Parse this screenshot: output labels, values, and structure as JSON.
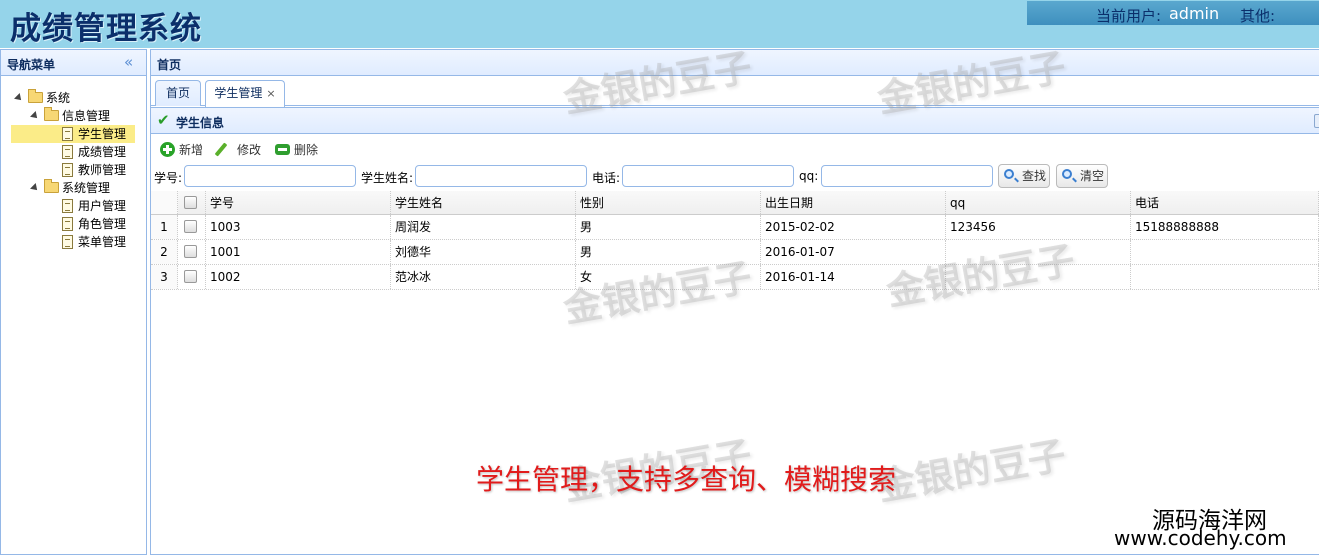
{
  "app": {
    "title": "成绩管理系统",
    "user_label": "当前用户:",
    "username": "admin",
    "other_label": "其他:"
  },
  "nav": {
    "title": "导航菜单",
    "tree": [
      {
        "label": "系统"
      },
      {
        "label": "信息管理"
      },
      {
        "label": "学生管理",
        "selected": true
      },
      {
        "label": "成绩管理"
      },
      {
        "label": "教师管理"
      },
      {
        "label": "系统管理"
      },
      {
        "label": "用户管理"
      },
      {
        "label": "角色管理"
      },
      {
        "label": "菜单管理"
      }
    ]
  },
  "center": {
    "title": "首页",
    "tabs": [
      {
        "label": "首页"
      },
      {
        "label": "学生管理",
        "closable": true,
        "active": true
      }
    ],
    "close_glyph": "×"
  },
  "grid": {
    "title": "学生信息",
    "toolbar": {
      "add": "新增",
      "edit": "修改",
      "delete": "删除"
    },
    "search": {
      "id_label": "学号:",
      "name_label": "学生姓名:",
      "phone_label": "电话:",
      "qq_label": "qq:",
      "search_button": "查找",
      "clear_button": "清空"
    },
    "columns": [
      "学号",
      "学生姓名",
      "性别",
      "出生日期",
      "qq",
      "电话"
    ],
    "rows": [
      {
        "n": "1",
        "id": "1003",
        "name": "周润发",
        "sex": "男",
        "birth": "2015-02-02",
        "qq": "123456",
        "phone": "15188888888"
      },
      {
        "n": "2",
        "id": "1001",
        "name": "刘德华",
        "sex": "男",
        "birth": "2016-01-07",
        "qq": "",
        "phone": ""
      },
      {
        "n": "3",
        "id": "1002",
        "name": "范冰冰",
        "sex": "女",
        "birth": "2016-01-14",
        "qq": "",
        "phone": ""
      }
    ]
  },
  "overlay": {
    "watermark": "金银的豆子",
    "caption": "学生管理，支持多查询、模糊搜索",
    "site_name": "源码海洋网",
    "site_url": "www.codehy.com"
  },
  "colors": {
    "header_bg": "#95d4ea",
    "title_color": "#0b2f6b",
    "panel_border": "#95b8e7",
    "selected_node": "#fbec88",
    "caption_color": "#e11b1b"
  }
}
